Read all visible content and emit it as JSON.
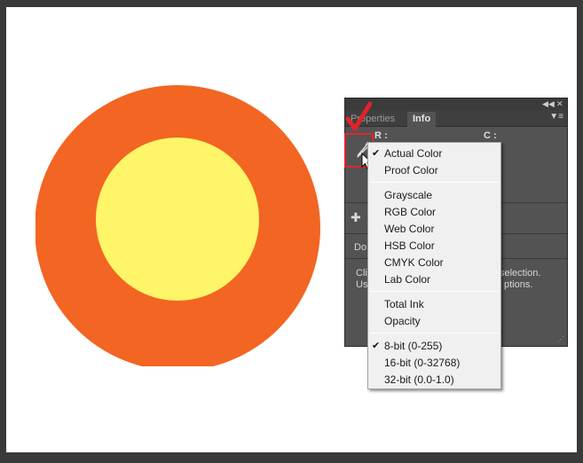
{
  "colors": {
    "outer_circle": "#f26522",
    "inner_circle": "#fff568",
    "canvas_bg": "#ffffff",
    "panel_bg": "#535353",
    "highlight": "#e0242b"
  },
  "panel": {
    "tabs": [
      {
        "label": "Properties",
        "active": false
      },
      {
        "label": "Info",
        "active": true
      }
    ],
    "collapse_icon": "collapse-icon",
    "close_icon": "close-icon",
    "menu_icon": "panel-menu-icon",
    "readout_left_label": "R :",
    "readout_right_label": "C :",
    "doc_text": "Do",
    "hint_line1_left": "Cli",
    "hint_line1_right": "selection.",
    "hint_line2_left": "Us",
    "hint_line2_right": "ptions."
  },
  "menu": {
    "items": [
      {
        "label": "Actual Color",
        "checked": true
      },
      {
        "label": "Proof Color",
        "checked": false
      },
      {
        "label": "Grayscale",
        "checked": false
      },
      {
        "label": "RGB Color",
        "checked": false
      },
      {
        "label": "Web Color",
        "checked": false
      },
      {
        "label": "HSB Color",
        "checked": false
      },
      {
        "label": "CMYK Color",
        "checked": false
      },
      {
        "label": "Lab Color",
        "checked": false
      },
      {
        "label": "Total Ink",
        "checked": false
      },
      {
        "label": "Opacity",
        "checked": false
      },
      {
        "label": "8-bit (0-255)",
        "checked": true
      },
      {
        "label": "16-bit (0-32768)",
        "checked": false
      },
      {
        "label": "32-bit (0.0-1.0)",
        "checked": false
      }
    ]
  }
}
